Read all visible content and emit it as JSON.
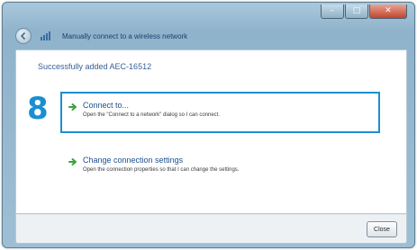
{
  "window": {
    "controls": {
      "minimize_glyph": "–",
      "maximize_glyph": "□",
      "close_glyph": "✕"
    },
    "nav_title": "Manually connect to a wireless network"
  },
  "content": {
    "success_message": "Successfully added AEC-16512",
    "step_number": "8",
    "tasks": [
      {
        "title": "Connect to...",
        "description": "Open the \"Connect to a network\" dialog so I can connect."
      },
      {
        "title": "Change connection settings",
        "description": "Open the connection properties so that I can change the settings."
      }
    ]
  },
  "footer": {
    "close_label": "Close"
  },
  "colors": {
    "highlight_accent": "#1a8fd1",
    "task_arrow": "#3ca13c",
    "link_text": "#1b4f8c"
  },
  "icons": {
    "back": "back-arrow-icon",
    "network": "wireless-network-icon",
    "task": "green-arrow-icon"
  }
}
